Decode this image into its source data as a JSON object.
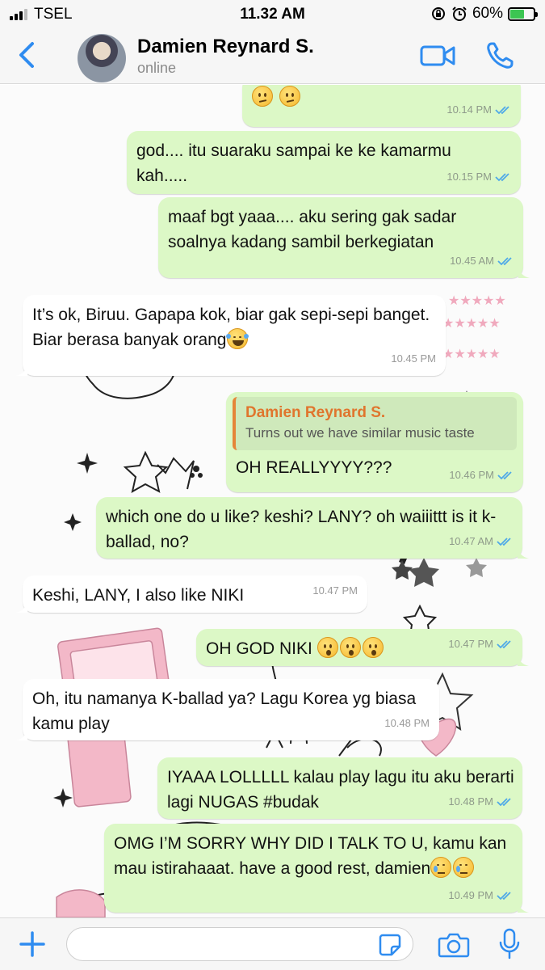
{
  "status_bar": {
    "carrier": "TSEL",
    "time": "11.32 AM",
    "battery": "60%",
    "battery_level": 0.6,
    "icons": [
      "signal-icon",
      "orientation-lock-icon",
      "alarm-icon",
      "battery-icon"
    ]
  },
  "header": {
    "name": "Damien Reynard S.",
    "status": "online",
    "icons": [
      "chevron-left-icon",
      "video-camera-icon",
      "phone-icon"
    ]
  },
  "colors": {
    "accent": "#2f8cf0",
    "outgoing_bubble": "#dcf8c6",
    "incoming_bubble": "#ffffff",
    "quote_name": "#e0752d",
    "read_ticks": "#4fa9e8"
  },
  "messages": [
    {
      "direction": "out",
      "parts": [
        "",
        ""
      ],
      "emoji": [
        "confused",
        "confused"
      ],
      "time": "10.14 PM",
      "read": true
    },
    {
      "direction": "out",
      "text": "god.... itu suaraku sampai ke ke kamarmu kah.....",
      "time": "10.15 PM",
      "read": true
    },
    {
      "direction": "out",
      "text": "maaf bgt yaaa.... aku sering gak sadar soalnya kadang sambil berkegiatan",
      "time": "10.45 AM",
      "read": true
    },
    {
      "direction": "in",
      "text": "It’s ok, Biruu. Gapapa kok, biar gak sepi-sepi banget. Biar berasa banyak orang",
      "emoji": [
        "laughing"
      ],
      "time": "10.45 PM"
    },
    {
      "direction": "out",
      "quote": {
        "name": "Damien Reynard S.",
        "text": "Turns out we have similar music taste"
      },
      "text": "OH REALLYYYY???",
      "time": "10.46 PM",
      "read": true
    },
    {
      "direction": "out",
      "text": "which one do u like? keshi? LANY? oh waiiittt is it k-ballad, no?",
      "time": "10.47 AM",
      "read": true
    },
    {
      "direction": "in",
      "text": "Keshi, LANY, I also like NIKI",
      "time": "10.47 PM"
    },
    {
      "direction": "out",
      "text": "OH GOD NIKI",
      "emoji": [
        "astonished",
        "astonished",
        "astonished"
      ],
      "time": "10.47 PM",
      "read": true
    },
    {
      "direction": "in",
      "text": "Oh, itu namanya K-ballad ya? Lagu Korea yg biasa kamu play",
      "time": "10.48 PM"
    },
    {
      "direction": "out",
      "text": "IYAAA LOLLLLL kalau play lagu itu aku berarti lagi NUGAS #budak",
      "time": "10.48 PM",
      "read": true
    },
    {
      "direction": "out",
      "text": "OMG I’M SORRY WHY DID I TALK TO U, kamu kan mau istirahaaat. have a good rest, damien",
      "emoji": [
        "sad",
        "sad"
      ],
      "time": "10.49 PM",
      "read": true
    }
  ],
  "input_bar": {
    "value": "",
    "icons": [
      "plus-icon",
      "sticker-icon",
      "camera-icon",
      "microphone-icon"
    ]
  }
}
